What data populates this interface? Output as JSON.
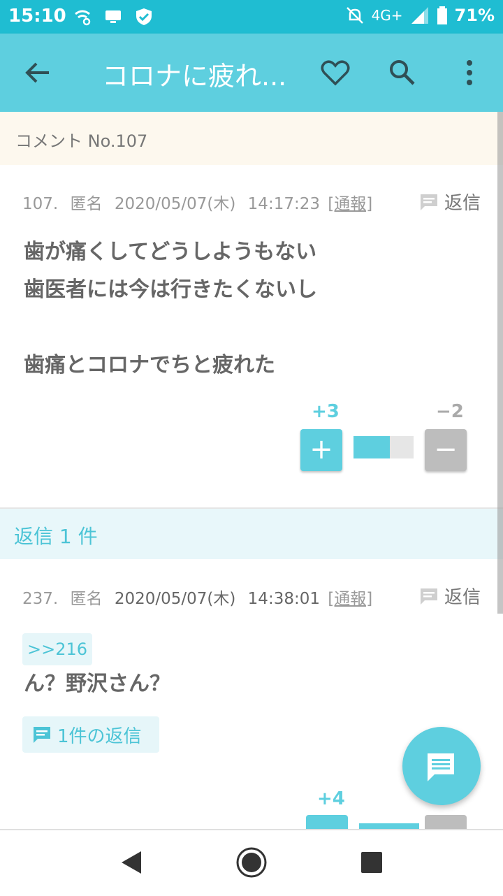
{
  "status_bar": {
    "time": "15:10",
    "network": "4G+",
    "battery": "71%",
    "icons": [
      "wifi-calling-icon",
      "screen-monitor-icon",
      "shield-check-icon",
      "notifications-off-icon",
      "signal-icon",
      "battery-icon"
    ]
  },
  "app_bar": {
    "title": "コロナに疲れ...",
    "icons": [
      "back-arrow-icon",
      "heart-icon",
      "search-icon",
      "more-vert-icon"
    ]
  },
  "section": {
    "label": "コメント No.107"
  },
  "comment": {
    "number": "107.",
    "author": "匿名",
    "date": "2020/05/07(木)",
    "time": "14:17:23",
    "report": "[通報]",
    "reply_label": "返信",
    "body": "歯が痛くしてどうしようもない\n歯医者には今は行きたくないし\n\n歯痛とコロナでちと疲れた",
    "plus_score": "+3",
    "minus_score": "−2",
    "plus_ratio": 0.6,
    "plus_button": "+",
    "minus_button": "−"
  },
  "replies_header": {
    "label": "返信 1 件"
  },
  "reply": {
    "number": "237.",
    "author": "匿名",
    "date": "2020/05/07(木)",
    "time": "14:38:01",
    "report": "[通報]",
    "reply_label": "返信",
    "anchor": ">>216",
    "body": "ん？野沢さん？",
    "replies_link": "1件の返信",
    "plus_score": "+4"
  },
  "colors": {
    "accent": "#5ecfdf",
    "status_bar": "#1fbdd2",
    "minus": "#bdbdbd"
  }
}
